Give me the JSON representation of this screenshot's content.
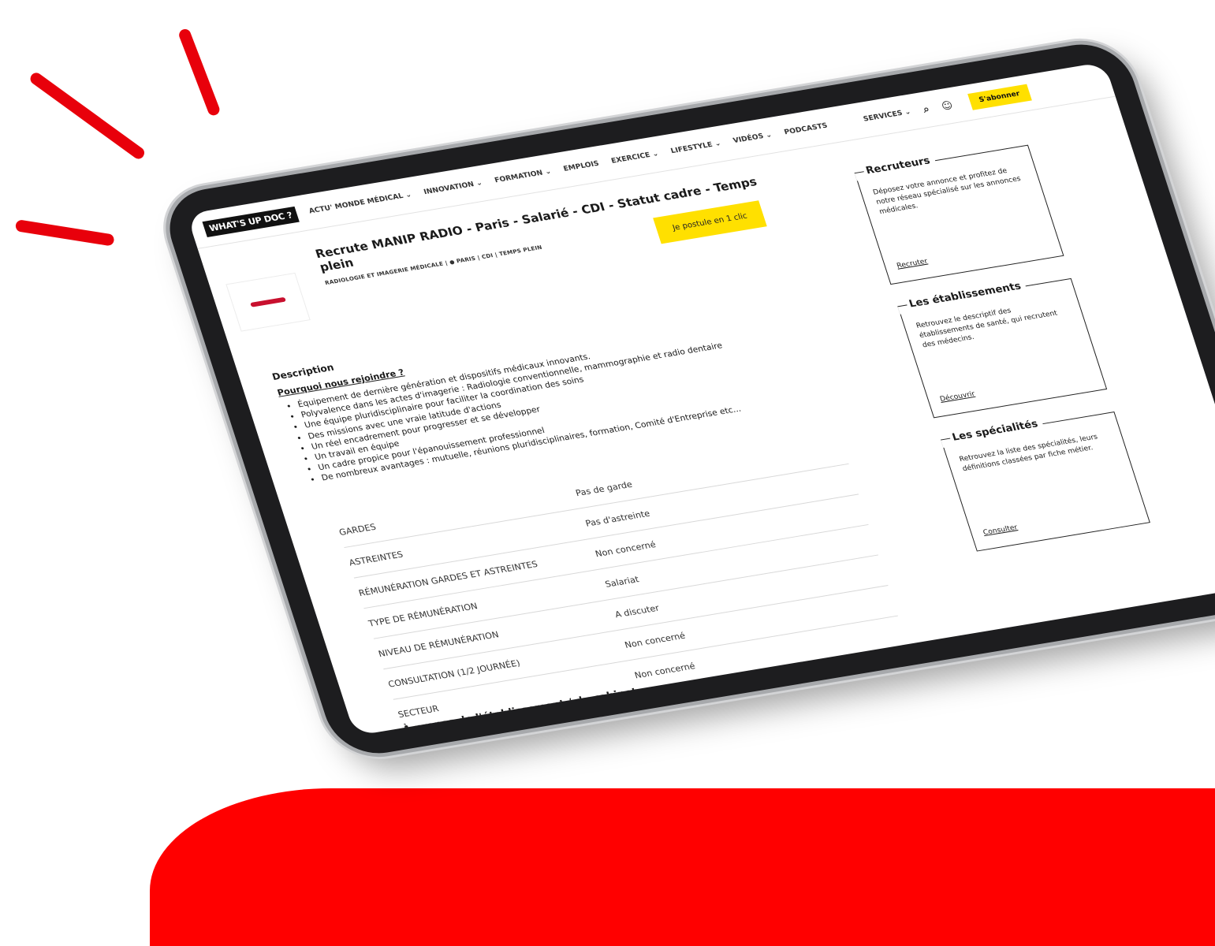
{
  "colors": {
    "accent": "#e8000b",
    "cta": "#ffe000",
    "bezel": "#1d1d1f"
  },
  "nav": {
    "logo": "WHAT'S UP DOC ?",
    "items": [
      "ACTU' MONDE MÉDICAL ⌄",
      "INNOVATION ⌄",
      "FORMATION ⌄",
      "EMPLOIS",
      "EXERCICE ⌄",
      "LIFESTYLE ⌄",
      "VIDÉOS ⌄",
      "PODCASTS",
      "SERVICES ⌄"
    ],
    "icons": [
      "search-icon",
      "user-icon"
    ],
    "subscribe": "S'abonner"
  },
  "job": {
    "title": "Recrute MANIP RADIO - Paris - Salarié - CDI - Statut cadre - Temps plein",
    "specialty": "RADIOLOGIE ET IMAGERIE MÉDICALE",
    "city": "PARIS",
    "contract": "CDI",
    "time": "TEMPS PLEIN",
    "apply_label": "Je postule en 1 clic"
  },
  "description": {
    "heading": "Description",
    "why": "Pourquoi nous rejoindre ?",
    "bullets": [
      "Équipement de dernière génération et dispositifs médicaux innovants.",
      "Polyvalence dans les actes d'imagerie : Radiologie conventionnelle, mammographie et radio dentaire",
      "Une équipe pluridisciplinaire pour faciliter la coordination des soins",
      "Des missions avec une vraie latitude d'actions",
      "Un réel encadrement pour progresser et se développer",
      "Un travail en équipe",
      "Un cadre propice pour l'épanouissement professionnel",
      "De nombreux avantages : mutuelle, réunions pluridisciplinaires, formation, Comité d'Entreprise etc..."
    ]
  },
  "details": [
    {
      "label": "GARDES",
      "value": "Pas de garde"
    },
    {
      "label": "ASTREINTES",
      "value": "Pas d'astreinte"
    },
    {
      "label": "RÉMUNÉRATION GARDES ET ASTREINTES",
      "value": "Non concerné"
    },
    {
      "label": "TYPE DE RÉMUNÉRATION",
      "value": "Salariat"
    },
    {
      "label": "NIVEAU DE RÉMUNÉRATION",
      "value": "A discuter"
    },
    {
      "label": "CONSULTATION (1/2 JOURNÉE)",
      "value": "Non concerné"
    },
    {
      "label": "SECTEUR",
      "value": "Non concerné"
    }
  ],
  "about": {
    "heading": "À propos de l'établissement / du cabinet"
  },
  "sidebar": [
    {
      "title": "Recruteurs",
      "text": "Déposez votre annonce et profitez de notre réseau spécialisé sur les annonces médicales.",
      "link": "Recruter"
    },
    {
      "title": "Les établissements",
      "text": "Retrouvez le descriptif des établissements de santé, qui recrutent des médecins.",
      "link": "Découvrir"
    },
    {
      "title": "Les spécialités",
      "text": "Retrouvez la liste des spécialités, leurs définitions classées par fiche métier.",
      "link": "Consulter"
    }
  ]
}
